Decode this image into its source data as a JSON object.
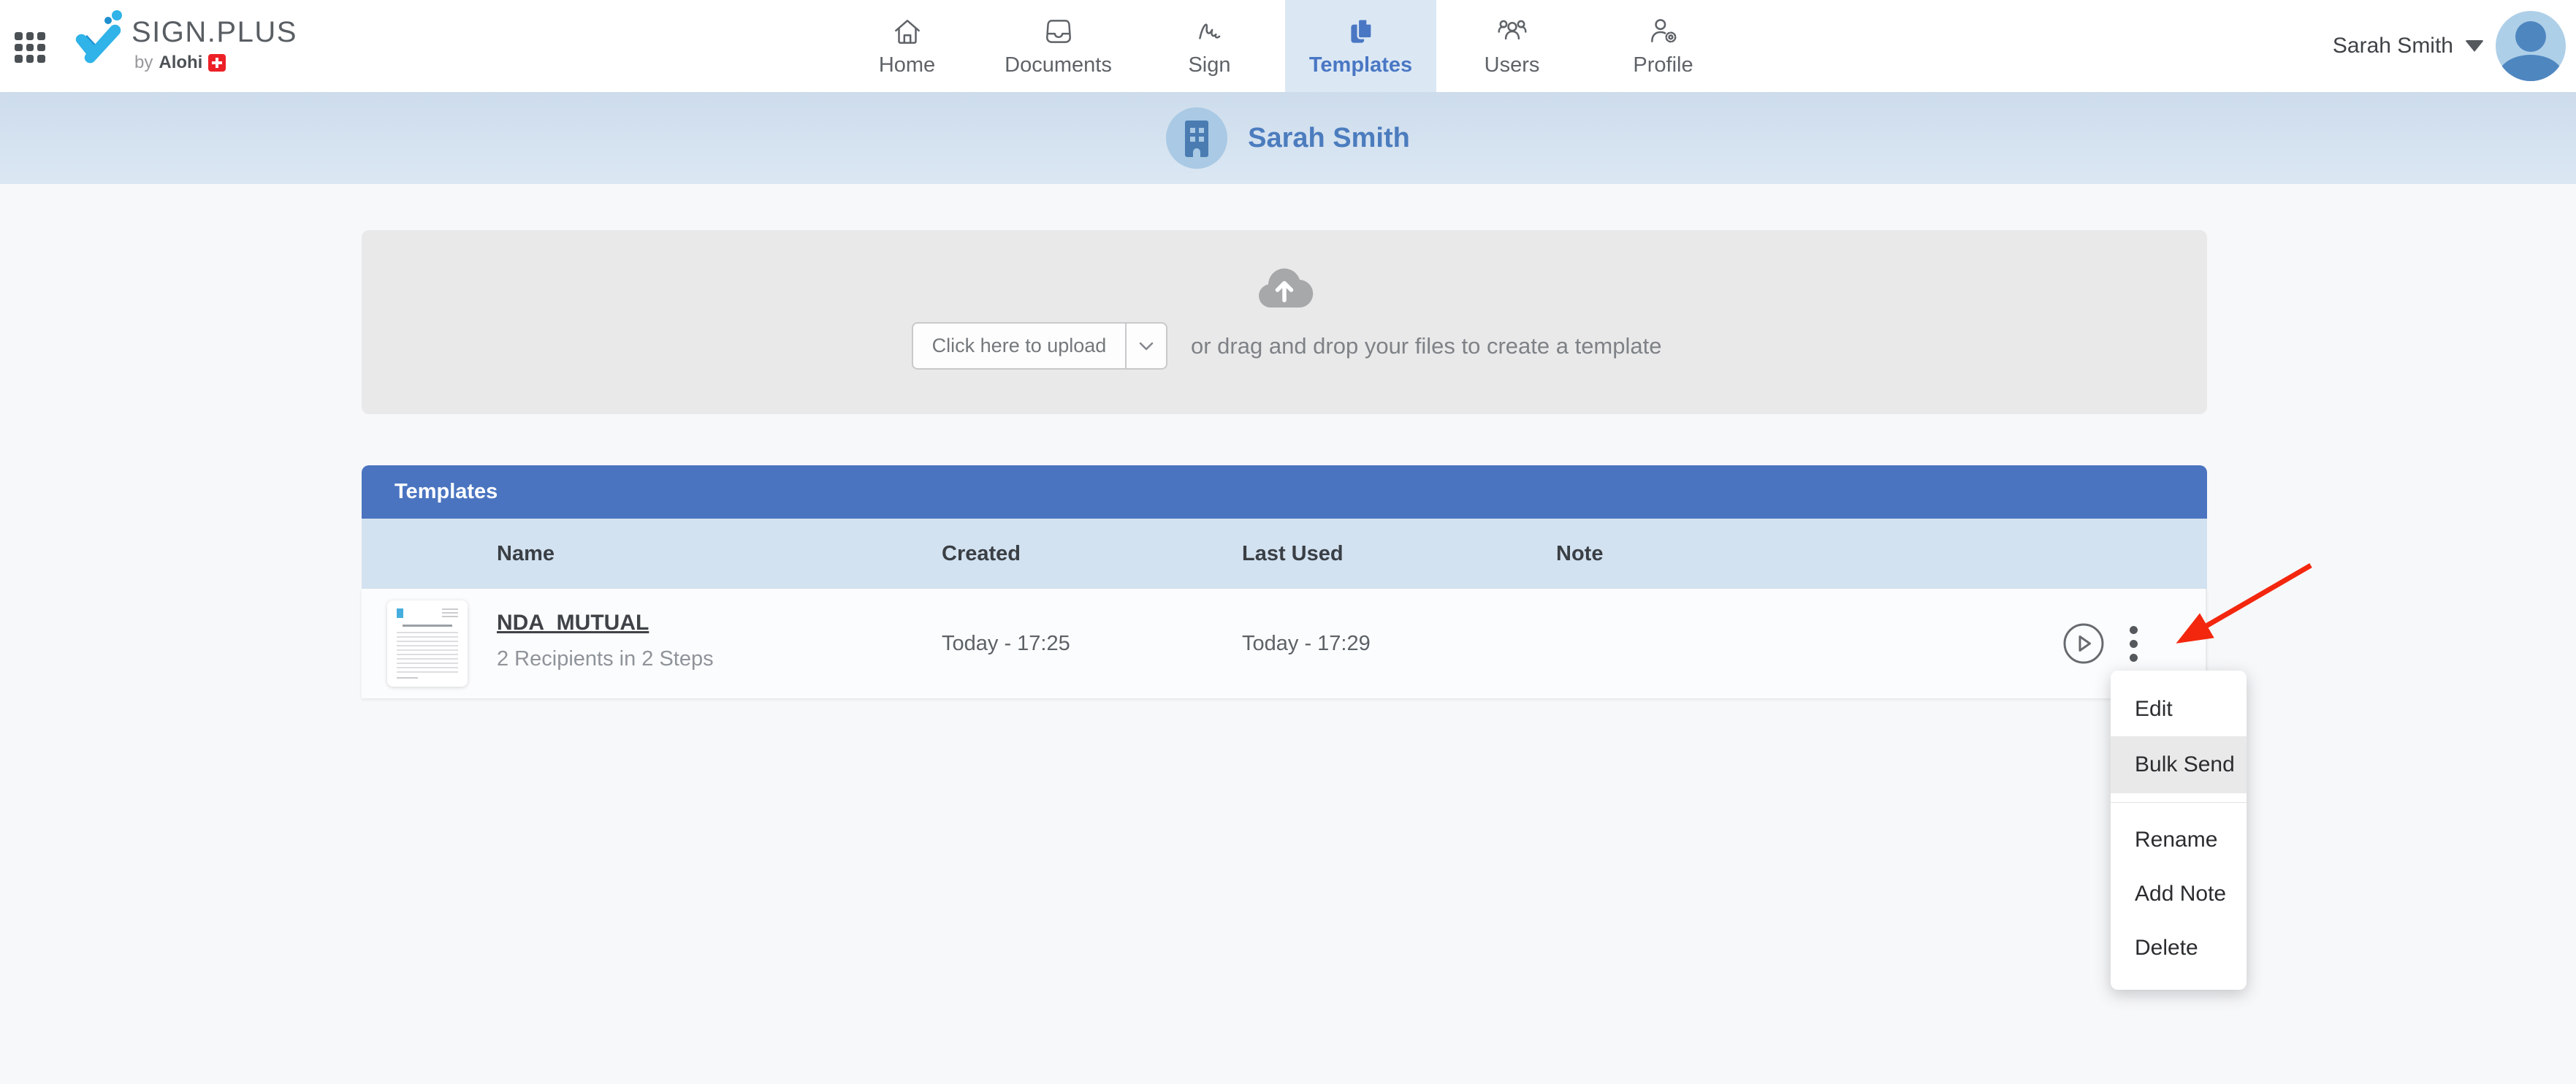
{
  "brand": {
    "product": "SIGN.PLUS",
    "byline_prefix": "by",
    "byline_company": "Alohi"
  },
  "nav": {
    "items": [
      {
        "label": "Home",
        "active": false
      },
      {
        "label": "Documents",
        "active": false
      },
      {
        "label": "Sign",
        "active": false
      },
      {
        "label": "Templates",
        "active": true
      },
      {
        "label": "Users",
        "active": false
      },
      {
        "label": "Profile",
        "active": false
      }
    ]
  },
  "user_menu": {
    "name": "Sarah Smith"
  },
  "account_header": {
    "name": "Sarah Smith"
  },
  "upload": {
    "button_label": "Click here to upload",
    "hint": "or drag and drop your files to create a template"
  },
  "templates_panel": {
    "title": "Templates",
    "columns": [
      "Name",
      "Created",
      "Last Used",
      "Note"
    ],
    "rows": [
      {
        "name": "NDA_MUTUAL",
        "details": "2 Recipients in 2 Steps",
        "created": "Today - 17:25",
        "last_used": "Today - 17:29",
        "note": ""
      }
    ]
  },
  "row_menu": {
    "items": [
      "Edit",
      "Bulk Send",
      "Rename",
      "Add Note",
      "Delete"
    ],
    "highlighted_item": "Bulk Send"
  },
  "colors": {
    "table_header_blue": "#4a74c0",
    "column_row_blue": "#d3e2f0",
    "active_tab_blue": "#4a77c4",
    "banner_blue": "#4b7cbe",
    "brand_check_blue": "#2fb3e8",
    "annotation_arrow_red": "#f3270e"
  }
}
